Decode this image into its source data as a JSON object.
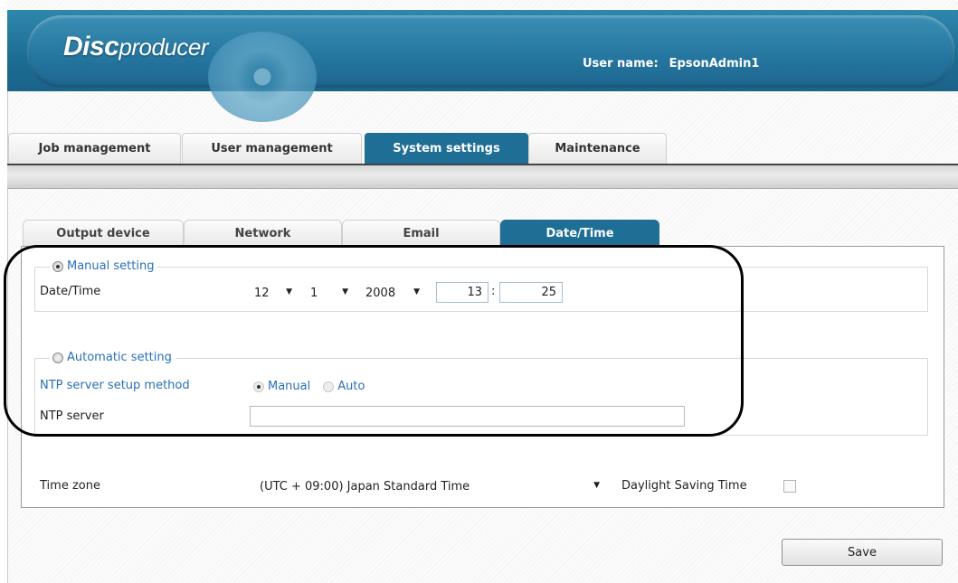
{
  "header": {
    "logo_bold": "Disc",
    "logo_rest": "producer",
    "user_label": "User name:",
    "user_value": "EpsonAdmin1"
  },
  "main_tabs": [
    {
      "label": "Job management"
    },
    {
      "label": "User management"
    },
    {
      "label": "System settings"
    },
    {
      "label": "Maintenance"
    }
  ],
  "sub_tabs": [
    {
      "label": "Output device"
    },
    {
      "label": "Network"
    },
    {
      "label": "Email"
    },
    {
      "label": "Date/Time"
    }
  ],
  "manual": {
    "legend": "Manual setting",
    "datetime_label": "Date/Time",
    "month": "12",
    "day": "1",
    "year": "2008",
    "hour": "13",
    "colon": ":",
    "minute": "25"
  },
  "automatic": {
    "legend": "Automatic setting",
    "method_label": "NTP server setup method",
    "opt_manual": "Manual",
    "opt_auto": "Auto",
    "server_label": "NTP server",
    "server_value": ""
  },
  "timezone": {
    "label": "Time zone",
    "value": "(UTC + 09:00) Japan Standard Time",
    "dst_label": "Daylight Saving Time"
  },
  "actions": {
    "save_label": "Save"
  },
  "colors": {
    "accent": "#1f6e96",
    "link_blue": "#2a6fb5"
  }
}
